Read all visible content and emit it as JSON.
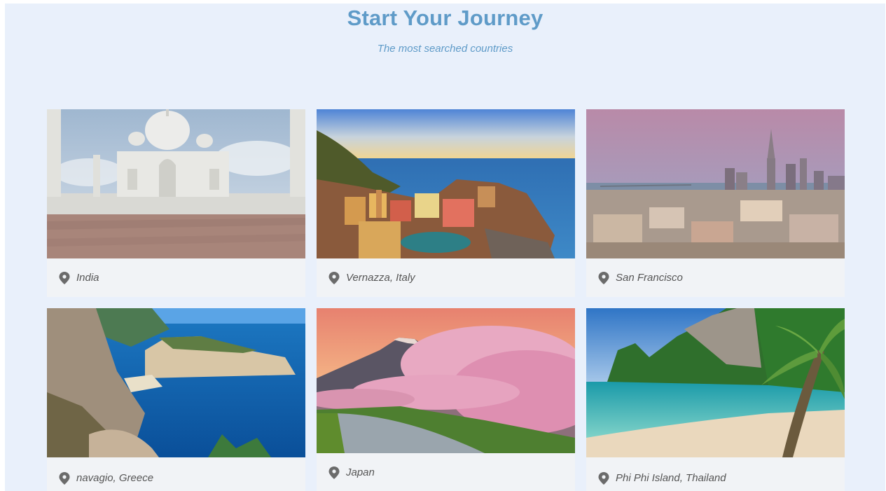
{
  "header": {
    "title": "Start Your Journey",
    "subtitle": "The most searched countries"
  },
  "destinations": [
    {
      "name": "India",
      "image": "taj-mahal"
    },
    {
      "name": "Vernazza, Italy",
      "image": "vernazza-coast"
    },
    {
      "name": "San Francisco",
      "image": "san-francisco-skyline"
    },
    {
      "name": "navagio, Greece",
      "image": "navagio-beach"
    },
    {
      "name": "Japan",
      "image": "mount-fuji-cherry-blossoms"
    },
    {
      "name": "Phi Phi Island, Thailand",
      "image": "phi-phi-beach"
    }
  ],
  "icons": {
    "location": "location-pin-icon"
  },
  "colors": {
    "background": "#e9f0fb",
    "heading": "#5f9bc8",
    "card": "#f1f3f6",
    "caption_text": "#555555",
    "pin": "#6b6b6b"
  }
}
